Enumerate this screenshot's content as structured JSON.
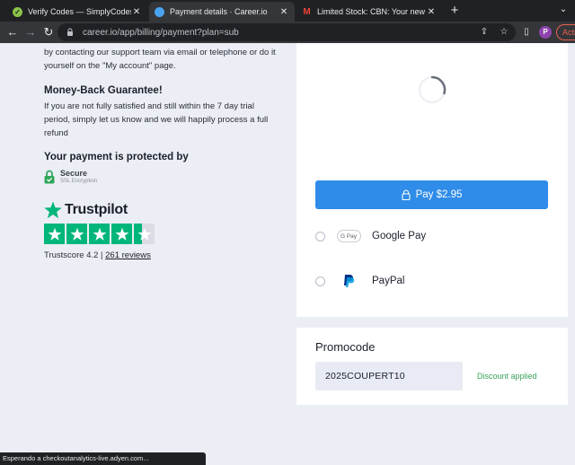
{
  "browser": {
    "tabs": [
      {
        "title": "Verify Codes — SimplyCodes",
        "active": false
      },
      {
        "title": "Payment details · Career.io",
        "active": true
      },
      {
        "title": "Limited Stock: CBN: Your new fav",
        "active": false
      }
    ],
    "url": "career.io/app/billing/payment?plan=sub",
    "profile_initial": "P",
    "activate_label": "Acti"
  },
  "intro": {
    "text": "by contacting our support team via email or telephone or do it yourself on the \"My account\" page."
  },
  "money_back": {
    "heading": "Money-Back Guarantee!",
    "body": "If you are not fully satisfied and still within the 7 day trial period, simply let us know and we will happily process a full refund"
  },
  "protection": {
    "heading": "Your payment is protected by",
    "secure_title": "Secure",
    "secure_subtitle": "SSL Encryption"
  },
  "trustpilot": {
    "brand": "Trustpilot",
    "rating_stars": 4.2,
    "score_label": "Trustscore 4.2",
    "separator": "|",
    "reviews_count": "261",
    "reviews_label": "reviews"
  },
  "payment": {
    "pay_button_label": "Pay $2.95",
    "methods": [
      {
        "label": "Google Pay",
        "badge": "G Pay"
      },
      {
        "label": "PayPal"
      }
    ]
  },
  "promo": {
    "title": "Promocode",
    "value": "2025COUPERT10",
    "status": "Discount applied"
  },
  "status_bar": {
    "text": "Esperando a checkoutanalytics-live.adyen.com..."
  },
  "colors": {
    "accent": "#2f8ce8",
    "trustpilot_green": "#00b67a",
    "success": "#3aa35b"
  }
}
